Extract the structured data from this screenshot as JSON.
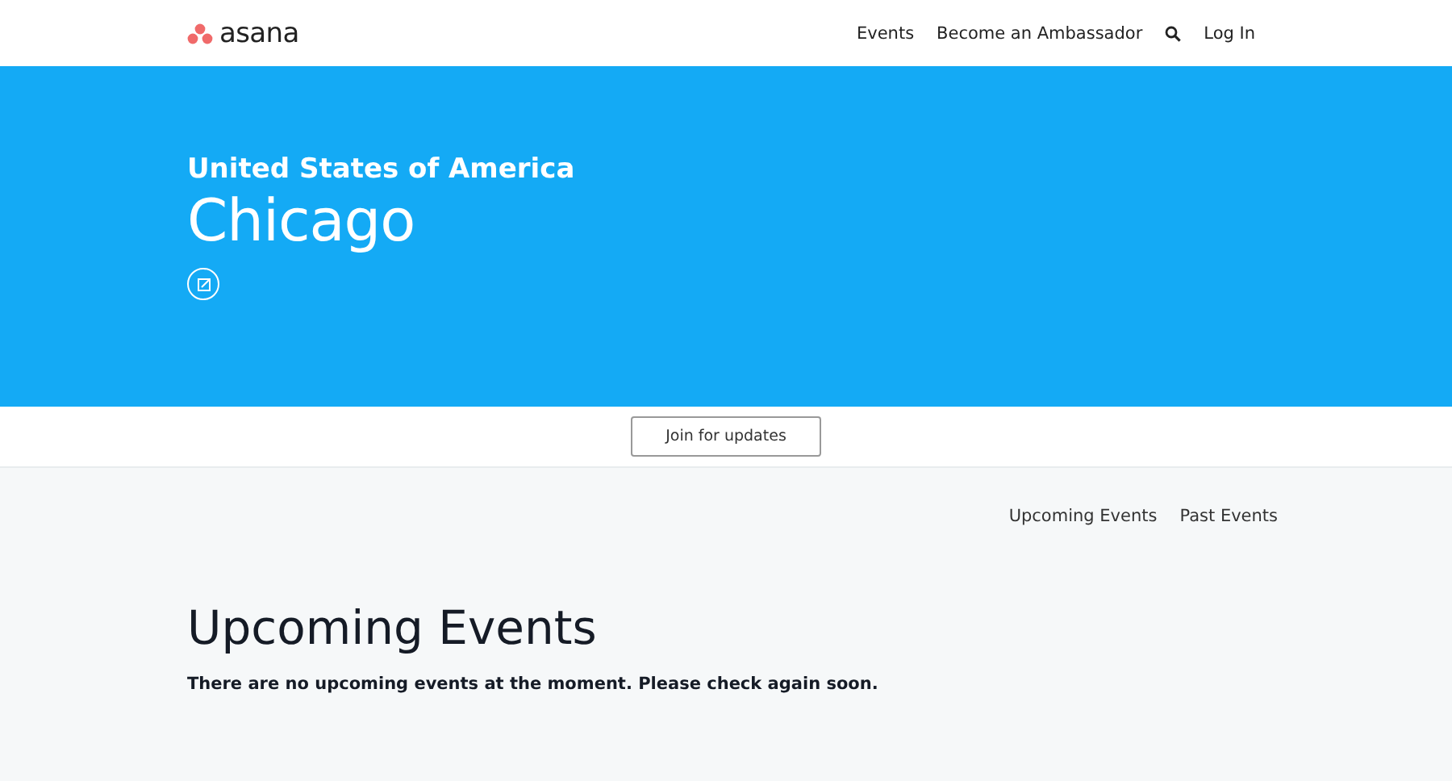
{
  "header": {
    "logo": "asana",
    "nav": [
      "Events",
      "Become an Ambassador"
    ],
    "login": "Log In"
  },
  "hero": {
    "country": "United States of America",
    "city": "Chicago"
  },
  "join_button": "Join for updates",
  "event_tabs": [
    "Upcoming Events",
    "Past Events"
  ],
  "section": {
    "title": "Upcoming Events",
    "message": "There are no upcoming events at the moment. Please check again soon."
  }
}
